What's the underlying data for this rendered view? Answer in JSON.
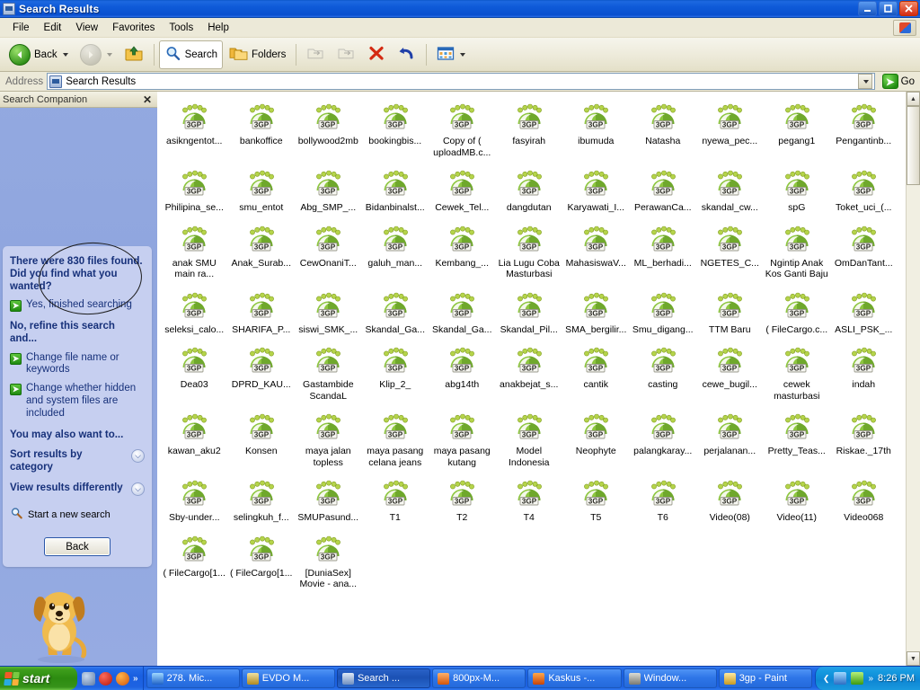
{
  "window": {
    "title": "Search Results",
    "title_icon": "search-results-icon",
    "buttons": {
      "minimize": "minimize-icon",
      "maximize": "maximize-icon",
      "close": "close-icon"
    }
  },
  "menubar": {
    "items": [
      "File",
      "Edit",
      "View",
      "Favorites",
      "Tools",
      "Help"
    ]
  },
  "toolbar": {
    "back": "Back",
    "forward": "",
    "up": "",
    "search": "Search",
    "folders": "Folders",
    "views": ""
  },
  "address": {
    "label": "Address",
    "value": "Search Results",
    "go": "Go"
  },
  "sidebar": {
    "header": "Search Companion",
    "close": "✕",
    "question": "There were 830 files found. Did you find what you wanted?",
    "yes_link": "Yes, finished searching",
    "refine_heading": "No, refine this search and...",
    "refine_links": [
      "Change file name or keywords",
      "Change whether hidden and system files are included"
    ],
    "also_heading": "You may also want to...",
    "options": [
      "Sort results by category",
      "View results differently"
    ],
    "new_search": "Start a new search",
    "back_button": "Back"
  },
  "results": {
    "file_type_badge": "3GP",
    "files": [
      "asikngentot...",
      "bankoffice",
      "bollywood2mb",
      "bookingbis...",
      "Copy of ( uploadMB.c...",
      "fasyirah",
      "ibumuda",
      "Natasha",
      "nyewa_pec...",
      "pegang1",
      "Pengantinb...",
      "Philipina_se...",
      "smu_entot",
      "Abg_SMP_...",
      "Bidanbinalst...",
      "Cewek_Tel...",
      "dangdutan",
      "Karyawati_I...",
      "PerawanCa...",
      "skandal_cw...",
      "spG",
      "Toket_uci_(...",
      "anak SMU main ra...",
      "Anak_Surab...",
      "CewOnaniT...",
      "galuh_man...",
      "Kembang_...",
      "Lia Lugu Coba Masturbasi",
      "MahasiswaV...",
      "ML_berhadi...",
      "NGETES_C...",
      "Ngintip Anak Kos Ganti Baju",
      "OmDanTant...",
      "seleksi_calo...",
      "SHARIFA_P...",
      "siswi_SMK_...",
      "Skandal_Ga...",
      "Skandal_Ga...",
      "Skandal_Pil...",
      "SMA_bergilir...",
      "Smu_digang...",
      "TTM Baru",
      "( FileCargo.c...",
      "ASLI_PSK_...",
      "Dea03",
      "DPRD_KAU...",
      "Gastambide ScandaL",
      "Klip_2_",
      "abg14th",
      "anakbejat_s...",
      "cantik",
      "casting",
      "cewe_bugil...",
      "cewek masturbasi",
      "indah",
      "kawan_aku2",
      "Konsen",
      "maya jalan topless",
      "maya pasang celana jeans",
      "maya pasang kutang",
      "Model Indonesia",
      "Neophyte",
      "palangkaray...",
      "perjalanan...",
      "Pretty_Teas...",
      "Riskae._17th",
      "Sby-under...",
      "selingkuh_f...",
      "SMUPasund...",
      "T1",
      "T2",
      "T4",
      "T5",
      "T6",
      "Video(08)",
      "Video(11)",
      "Video068",
      "( FileCargo[1...",
      "( FileCargo[1...",
      "[DuniaSex] Movie - ana..."
    ]
  },
  "scrollbar": {
    "up": "▲",
    "down": "▼"
  },
  "taskbar": {
    "start": "start",
    "quick_launch_chevron": "»",
    "tasks": [
      {
        "label": "278. Mic...",
        "icon": "ie-icon",
        "active": false
      },
      {
        "label": "EVDO M...",
        "icon": "modem-icon",
        "active": false
      },
      {
        "label": "Search ...",
        "icon": "search-results-icon",
        "active": true
      },
      {
        "label": "800px-M...",
        "icon": "opera-icon",
        "active": false
      },
      {
        "label": "Kaskus -...",
        "icon": "firefox-icon",
        "active": false
      },
      {
        "label": "Window...",
        "icon": "window-icon",
        "active": false
      },
      {
        "label": "3gp - Paint",
        "icon": "paint-icon",
        "active": false
      }
    ],
    "tray_chevron": "❮",
    "clock": "8:26 PM"
  },
  "colors": {
    "title_blue": "#0a50cf",
    "taskbar_blue": "#1e63e2",
    "start_green": "#2c8b10",
    "sidebar_blue": "#8fa5de",
    "sidebar_panel": "#c6cff0",
    "link_text": "#17317a",
    "icon_green": "#8cc63f"
  }
}
